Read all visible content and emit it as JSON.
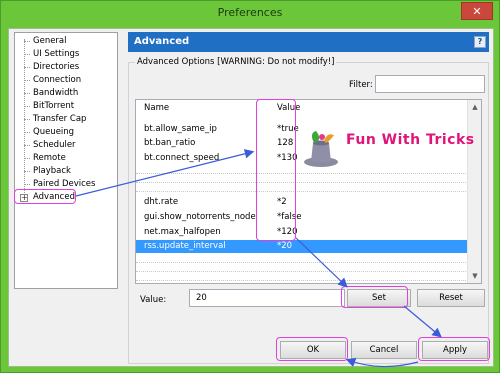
{
  "window": {
    "title": "Preferences",
    "close_glyph": "✕"
  },
  "sidebar": {
    "items": [
      {
        "label": "General"
      },
      {
        "label": "UI Settings"
      },
      {
        "label": "Directories"
      },
      {
        "label": "Connection"
      },
      {
        "label": "Bandwidth"
      },
      {
        "label": "BitTorrent"
      },
      {
        "label": "Transfer Cap"
      },
      {
        "label": "Queueing"
      },
      {
        "label": "Scheduler"
      },
      {
        "label": "Remote"
      },
      {
        "label": "Playback"
      },
      {
        "label": "Paired Devices"
      },
      {
        "label": "Advanced",
        "expander": "+"
      }
    ]
  },
  "panel": {
    "title": "Advanced",
    "help_glyph": "?",
    "group_label": "Advanced Options [WARNING: Do not modify!]",
    "filter_label": "Filter:",
    "filter_value": ""
  },
  "list": {
    "headers": {
      "name": "Name",
      "value": "Value"
    },
    "rows": [
      {
        "name": "bt.allow_same_ip",
        "value": "*true"
      },
      {
        "name": "bt.ban_ratio",
        "value": "128"
      },
      {
        "name": "bt.connect_speed",
        "value": "*130"
      },
      {
        "name": "dht.rate",
        "value": "*2"
      },
      {
        "name": "gui.show_notorrents_node",
        "value": "*false"
      },
      {
        "name": "net.max_halfopen",
        "value": "*120"
      },
      {
        "name": "rss.update_interval",
        "value": "*20"
      }
    ]
  },
  "editor": {
    "value_label": "Value:",
    "value": "20",
    "set_label": "Set",
    "reset_label": "Reset"
  },
  "footer": {
    "ok_label": "OK",
    "cancel_label": "Cancel",
    "apply_label": "Apply"
  },
  "watermark": "Fun With Tricks",
  "colors": {
    "highlight": "#e040e0",
    "arrow": "#3b5bdb",
    "selection": "#3399ff",
    "header": "#1f6fc5"
  }
}
